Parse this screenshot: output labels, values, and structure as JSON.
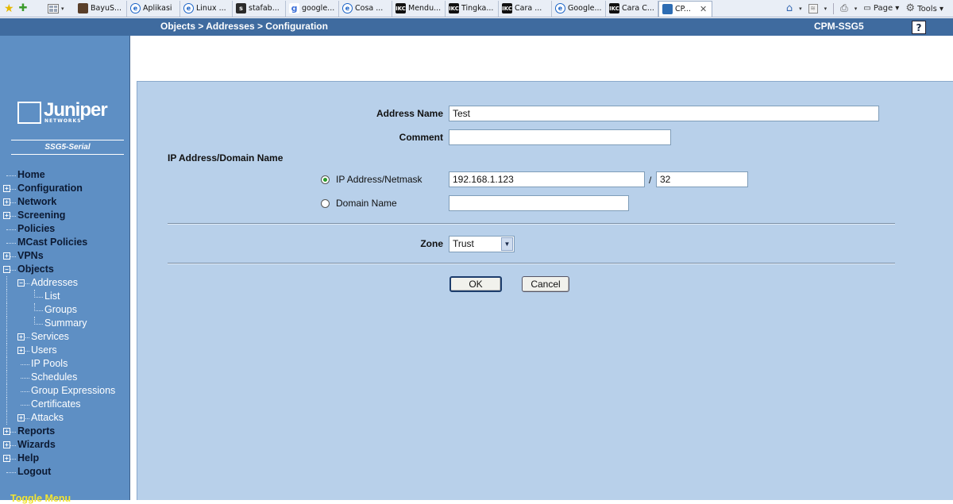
{
  "browser": {
    "tabs": [
      {
        "label": "BayuS...",
        "icon": "bookmark-icon"
      },
      {
        "label": "Aplikasi",
        "icon": "ie-icon"
      },
      {
        "label": "Linux ...",
        "icon": "ie-icon"
      },
      {
        "label": "stafab...",
        "icon": "stafab-icon"
      },
      {
        "label": "google...",
        "icon": "google-icon"
      },
      {
        "label": "Cosa ...",
        "icon": "ie-icon"
      },
      {
        "label": "Mendu...",
        "icon": "ikc-icon"
      },
      {
        "label": "Tingka...",
        "icon": "ikc-icon"
      },
      {
        "label": "Cara ...",
        "icon": "ikc-icon"
      },
      {
        "label": "Google...",
        "icon": "ie-icon"
      },
      {
        "label": "Cara C...",
        "icon": "ikc-icon"
      },
      {
        "label": "CP...",
        "icon": "page-icon",
        "active": true
      }
    ],
    "toolbar": {
      "page_label": "Page",
      "tools_label": "Tools"
    }
  },
  "topbar": {
    "breadcrumb": "Objects > Addresses > Configuration",
    "device_name": "CPM-SSG5",
    "help_label": "?"
  },
  "sidebar": {
    "logo_text": "Juniper",
    "logo_sub": "NETWORKS",
    "model": "SSG5-Serial",
    "items": [
      {
        "label": "Home",
        "level": 0,
        "expander": ""
      },
      {
        "label": "Configuration",
        "level": 0,
        "expander": "+"
      },
      {
        "label": "Network",
        "level": 0,
        "expander": "+"
      },
      {
        "label": "Screening",
        "level": 0,
        "expander": "+"
      },
      {
        "label": "Policies",
        "level": 0,
        "expander": ""
      },
      {
        "label": "MCast Policies",
        "level": 0,
        "expander": ""
      },
      {
        "label": "VPNs",
        "level": 0,
        "expander": "+"
      },
      {
        "label": "Objects",
        "level": 0,
        "expander": "-"
      },
      {
        "label": "Addresses",
        "level": 1,
        "expander": "-"
      },
      {
        "label": "List",
        "level": 2,
        "expander": ""
      },
      {
        "label": "Groups",
        "level": 2,
        "expander": ""
      },
      {
        "label": "Summary",
        "level": 2,
        "expander": ""
      },
      {
        "label": "Services",
        "level": 1,
        "expander": "+"
      },
      {
        "label": "Users",
        "level": 1,
        "expander": "+"
      },
      {
        "label": "IP Pools",
        "level": 1,
        "expander": ""
      },
      {
        "label": "Schedules",
        "level": 1,
        "expander": ""
      },
      {
        "label": "Group Expressions",
        "level": 1,
        "expander": ""
      },
      {
        "label": "Certificates",
        "level": 1,
        "expander": ""
      },
      {
        "label": "Attacks",
        "level": 1,
        "expander": "+"
      },
      {
        "label": "Reports",
        "level": 0,
        "expander": "+"
      },
      {
        "label": "Wizards",
        "level": 0,
        "expander": "+"
      },
      {
        "label": "Help",
        "level": 0,
        "expander": "+"
      },
      {
        "label": "Logout",
        "level": 0,
        "expander": ""
      }
    ],
    "toggle_menu": "Toggle Menu"
  },
  "form": {
    "address_name_label": "Address Name",
    "address_name_value": "Test",
    "comment_label": "Comment",
    "comment_value": "",
    "section_label": "IP Address/Domain Name",
    "ip_radio_label": "IP Address/Netmask",
    "ip_radio_checked": true,
    "ip_value": "192.168.1.123",
    "slash": "/",
    "netmask_value": "32",
    "domain_radio_label": "Domain Name",
    "domain_value": "",
    "zone_label": "Zone",
    "zone_value": "Trust",
    "ok_label": "OK",
    "cancel_label": "Cancel"
  }
}
